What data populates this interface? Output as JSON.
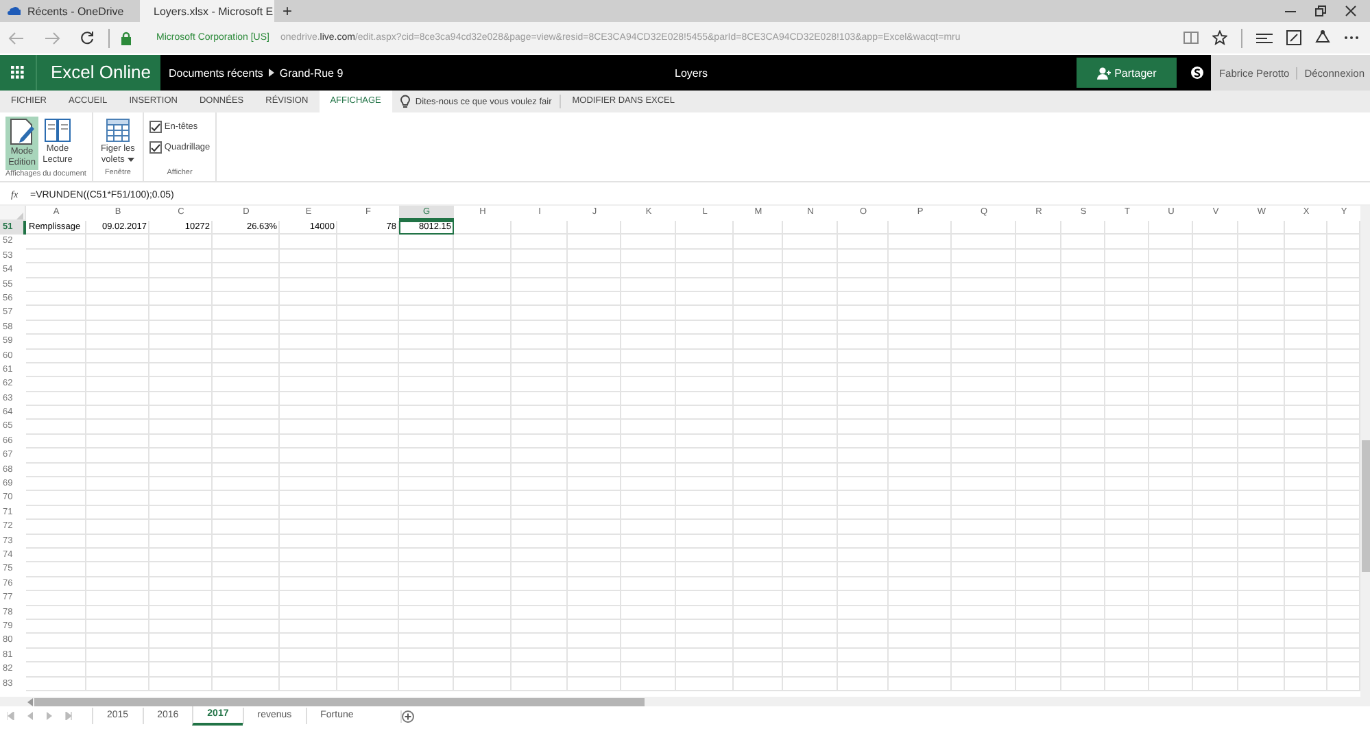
{
  "browser": {
    "tabs": [
      {
        "title": "Récents - OneDrive",
        "selected": false
      },
      {
        "title": "Loyers.xlsx - Microsoft E",
        "selected": true
      }
    ],
    "new_tab": "+",
    "address": {
      "identity": "Microsoft Corporation [US]",
      "url_prefix": "onedrive.",
      "url_host": "live.com",
      "url_path": "/edit.aspx?cid=8ce3ca94cd32e028&page=view&resid=8CE3CA94CD32E028!5455&parId=8CE3CA94CD32E028!103&app=Excel&wacqt=mru"
    }
  },
  "app_bar": {
    "app_name": "Excel Online",
    "breadcrumb": [
      "Documents récents",
      "Grand-Rue 9"
    ],
    "document_title": "Loyers",
    "share_button": "Partager",
    "user": "Fabrice Perotto",
    "sign_out": "Déconnexion"
  },
  "ribbon": {
    "tabs": [
      {
        "label": "FICHIER",
        "selected": false
      },
      {
        "label": "ACCUEIL",
        "selected": false
      },
      {
        "label": "INSERTION",
        "selected": false
      },
      {
        "label": "DONNÉES",
        "selected": false
      },
      {
        "label": "RÉVISION",
        "selected": false
      },
      {
        "label": "AFFICHAGE",
        "selected": true
      }
    ],
    "tell_me": "Dites-nous ce que vous voulez fair",
    "edit_in_excel": "MODIFIER DANS EXCEL",
    "groups": [
      {
        "label": "Affichages du document",
        "items": [
          {
            "kind": "mode",
            "label": "Mode Edition",
            "selected": true
          },
          {
            "kind": "mode",
            "label": "Mode Lecture",
            "selected": false
          }
        ]
      },
      {
        "label": "Fenêtre",
        "items": [
          {
            "kind": "dropdown",
            "label": "Figer les volets"
          }
        ]
      },
      {
        "label": "Afficher",
        "items": [
          {
            "kind": "checkbox",
            "label": "En-têtes",
            "checked": true
          },
          {
            "kind": "checkbox",
            "label": "Quadrillage",
            "checked": true
          }
        ]
      }
    ]
  },
  "formula_bar": {
    "function_symbol": "fx",
    "formula": "=VRUNDEN((C51*F51/100);0.05)"
  },
  "sheet": {
    "columns": [
      {
        "letter": "A",
        "selected": false
      },
      {
        "letter": "B",
        "selected": false
      },
      {
        "letter": "C",
        "selected": false
      },
      {
        "letter": "D",
        "selected": false
      },
      {
        "letter": "E",
        "selected": false
      },
      {
        "letter": "F",
        "selected": false
      },
      {
        "letter": "G",
        "selected": true
      },
      {
        "letter": "H",
        "selected": false
      },
      {
        "letter": "I",
        "selected": false
      },
      {
        "letter": "J",
        "selected": false
      },
      {
        "letter": "K",
        "selected": false
      },
      {
        "letter": "L",
        "selected": false
      },
      {
        "letter": "M",
        "selected": false
      },
      {
        "letter": "N",
        "selected": false
      },
      {
        "letter": "O",
        "selected": false
      },
      {
        "letter": "P",
        "selected": false
      },
      {
        "letter": "Q",
        "selected": false
      },
      {
        "letter": "R",
        "selected": false
      },
      {
        "letter": "S",
        "selected": false
      },
      {
        "letter": "T",
        "selected": false
      },
      {
        "letter": "U",
        "selected": false
      },
      {
        "letter": "V",
        "selected": false
      },
      {
        "letter": "W",
        "selected": false
      },
      {
        "letter": "X",
        "selected": false
      },
      {
        "letter": "Y",
        "selected": false
      }
    ],
    "rows": [
      {
        "number": "51",
        "selected": true,
        "cells": [
          {
            "kind": "text",
            "value": "Remplissage",
            "selected": false
          },
          {
            "kind": "number",
            "value": "09.02.2017",
            "selected": false
          },
          {
            "kind": "number",
            "value": "10272",
            "selected": false
          },
          {
            "kind": "number",
            "value": "26.63%",
            "selected": false
          },
          {
            "kind": "number",
            "value": "14000",
            "selected": false
          },
          {
            "kind": "number",
            "value": "78",
            "selected": false
          },
          {
            "kind": "number",
            "value": "8012.15",
            "selected": true
          }
        ]
      },
      {
        "number": "52",
        "selected": false
      },
      {
        "number": "53",
        "selected": false
      },
      {
        "number": "54",
        "selected": false
      },
      {
        "number": "55",
        "selected": false
      },
      {
        "number": "56",
        "selected": false
      },
      {
        "number": "57",
        "selected": false
      },
      {
        "number": "58",
        "selected": false
      },
      {
        "number": "59",
        "selected": false
      },
      {
        "number": "60",
        "selected": false
      },
      {
        "number": "61",
        "selected": false
      },
      {
        "number": "62",
        "selected": false
      },
      {
        "number": "63",
        "selected": false
      },
      {
        "number": "64",
        "selected": false
      },
      {
        "number": "65",
        "selected": false
      },
      {
        "number": "66",
        "selected": false
      },
      {
        "number": "67",
        "selected": false
      },
      {
        "number": "68",
        "selected": false
      },
      {
        "number": "69",
        "selected": false
      },
      {
        "number": "70",
        "selected": false
      },
      {
        "number": "71",
        "selected": false
      },
      {
        "number": "72",
        "selected": false
      },
      {
        "number": "73",
        "selected": false
      },
      {
        "number": "74",
        "selected": false
      },
      {
        "number": "75",
        "selected": false
      },
      {
        "number": "76",
        "selected": false
      },
      {
        "number": "77",
        "selected": false
      },
      {
        "number": "78",
        "selected": false
      },
      {
        "number": "79",
        "selected": false
      },
      {
        "number": "80",
        "selected": false
      },
      {
        "number": "81",
        "selected": false
      },
      {
        "number": "82",
        "selected": false
      },
      {
        "number": "83",
        "selected": false
      }
    ],
    "tabs": [
      {
        "label": "2015",
        "selected": false
      },
      {
        "label": "2016",
        "selected": false
      },
      {
        "label": "2017",
        "selected": true
      },
      {
        "label": "revenus",
        "selected": false
      },
      {
        "label": "Fortune",
        "selected": false
      }
    ]
  }
}
